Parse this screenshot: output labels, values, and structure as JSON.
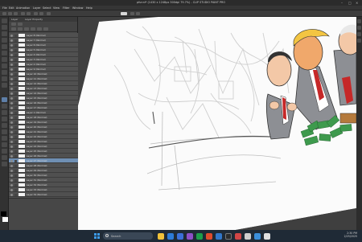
{
  "window": {
    "title": "pfunni* (1430 x 1248px 300dpi 79.7%) - CLIP STUDIO PAINT PRO",
    "min_glyph": "–",
    "max_glyph": "□",
    "close_glyph": "×"
  },
  "menu": [
    "File",
    "Edit",
    "Animation",
    "Layer",
    "Select",
    "View",
    "Filter",
    "Window",
    "Help"
  ],
  "panel": {
    "tabs": [
      "Layer",
      "Layer Property"
    ],
    "layers": [
      {
        "name": "Layer 8 (Normal)"
      },
      {
        "name": "Layer 7 (Normal)"
      },
      {
        "name": "Layer 6 (Normal)"
      },
      {
        "name": "Layer 5 (Normal)"
      },
      {
        "name": "Layer 4 (Normal)"
      },
      {
        "name": "Layer 3 (Normal)"
      },
      {
        "name": "Layer 2 (Normal)"
      },
      {
        "name": "Layer 9 (Normal)"
      },
      {
        "name": "Layer 10 (Normal)"
      },
      {
        "name": "Layer 11 (Normal)"
      },
      {
        "name": "Layer 12 (Normal)"
      },
      {
        "name": "Layer 13 (Normal)"
      },
      {
        "name": "Layer 14 (Normal)"
      },
      {
        "name": "Layer 15 (Normal)"
      },
      {
        "name": "Layer 16 (Normal)"
      },
      {
        "name": "Layer 17 (Normal)"
      },
      {
        "name": "Layer 1 (Normal)"
      },
      {
        "name": "Layer 18 (Normal)"
      },
      {
        "name": "Layer 19 (Normal)"
      },
      {
        "name": "Layer 20 (Normal)"
      },
      {
        "name": "Layer 21 (Normal)"
      },
      {
        "name": "Layer 22 (Normal)"
      },
      {
        "name": "Layer 23 (Normal)"
      },
      {
        "name": "Layer 24 (Normal)"
      },
      {
        "name": "Layer 25 (Normal)"
      },
      {
        "name": "Layer 26 (Normal)"
      },
      {
        "name": "Layer 27 (Normal)"
      },
      {
        "name": "Layer 28 (Normal)"
      },
      {
        "name": "Layer 29 (Normal)"
      },
      {
        "name": "Layer 30 (Normal)"
      },
      {
        "name": "Layer 31 (Normal)"
      },
      {
        "name": "Layer 32 (Normal)"
      },
      {
        "name": "Layer 33 (Normal)"
      },
      {
        "name": "Layer 34 (Normal)"
      },
      {
        "name": "Layer 35 (Normal)"
      },
      {
        "name": "Layer 36 (Normal)"
      },
      {
        "name": "Layer 37 (Normal)"
      }
    ],
    "selected_index": 26
  },
  "taskbar": {
    "search_placeholder": "Search",
    "time": "2:30 PM",
    "date": "2/25/2025"
  },
  "colors": {
    "accent": "#6f8fb3",
    "taskbar": "#1f2a36"
  },
  "icons": [
    "windows-start-icon",
    "search-icon",
    "eye-icon",
    "lock-icon"
  ]
}
